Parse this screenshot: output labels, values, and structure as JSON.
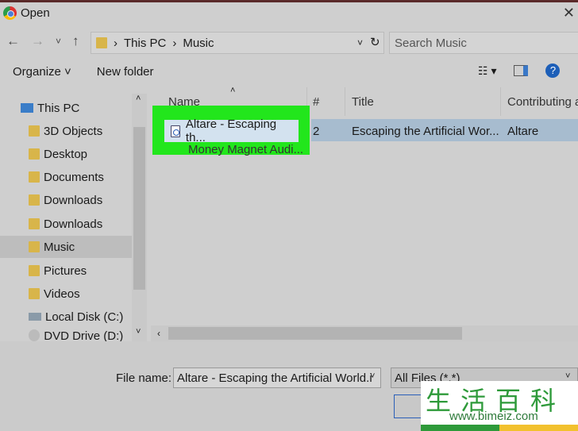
{
  "window": {
    "title": "Open",
    "close": "✕"
  },
  "nav": {
    "back": "←",
    "forward": "→",
    "recent": "˅",
    "up": "↑"
  },
  "address": {
    "crumbs": [
      "This PC",
      "Music"
    ],
    "sep": "›",
    "dropdown": "˅",
    "refresh": "↻"
  },
  "search": {
    "placeholder": "Search Music",
    "icon": "⚲"
  },
  "toolbar": {
    "organize": "Organize ˅",
    "new_folder": "New folder"
  },
  "sidebar": {
    "items": [
      {
        "label": "This PC"
      },
      {
        "label": "3D Objects"
      },
      {
        "label": "Desktop"
      },
      {
        "label": "Documents"
      },
      {
        "label": "Downloads"
      },
      {
        "label": "Downloads"
      },
      {
        "label": "Music",
        "selected": true
      },
      {
        "label": "Pictures"
      },
      {
        "label": "Videos"
      },
      {
        "label": "Local Disk (C:)"
      },
      {
        "label": "DVD Drive (D:) M"
      }
    ]
  },
  "columns": {
    "name": "Name",
    "num": "#",
    "title": "Title",
    "artist": "Contributing a"
  },
  "files": [
    {
      "name": "Altare - Escaping th...",
      "num": "2",
      "title": "Escaping the Artificial Wor...",
      "artist": "Altare",
      "selected": true
    },
    {
      "name": "Money Magnet Audi..."
    }
  ],
  "highlight_color": "#22e61c",
  "footer": {
    "file_name_label": "File name:",
    "file_name_value": "Altare - Escaping the Artificial World.i",
    "file_type": "All Files (*.*)"
  },
  "watermark": {
    "text": "生活百科",
    "url": "www.bimeiz.com"
  }
}
